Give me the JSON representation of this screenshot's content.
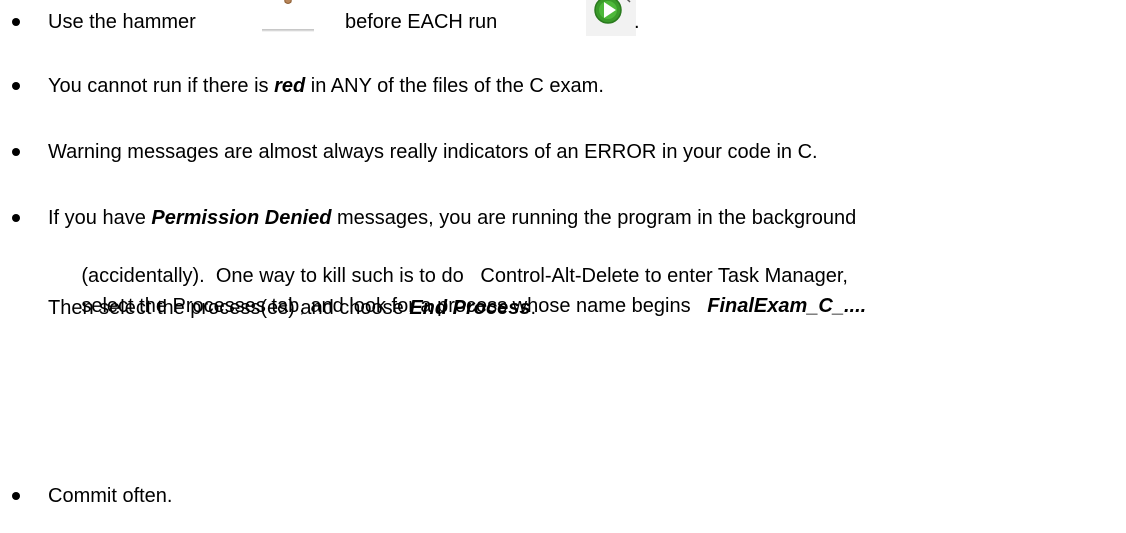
{
  "document": {
    "bullets": [
      {
        "parts": {
          "a": "Use the hammer",
          "b": "before EACH run",
          "c": "."
        }
      },
      {
        "parts": {
          "a": "You cannot run if there is ",
          "b": "red",
          "c": " in ANY of the files of the C exam."
        }
      },
      {
        "parts": {
          "a": "Warning messages are almost always really indicators of an ERROR in your code in C."
        }
      },
      {
        "lines": {
          "l1a": "If you have ",
          "l1b": "Permission Denied",
          "l1c": " messages, you are running the program in the background",
          "l2": "(accidentally).  One way to kill such is to do   Control-Alt-Delete to enter Task Manager,",
          "l3a": "select the Processes tab, and look for a process whose name begins   ",
          "l3b": "FinalExam_C_....",
          "l4a": "Then select the process(es) and choose ",
          "l4b": "End Process",
          "l4c": "."
        }
      },
      {
        "parts": {
          "a": "Commit often."
        }
      }
    ],
    "icons": {
      "hammer": "hammer-icon",
      "run": "run-icon"
    },
    "colors": {
      "text": "#000000",
      "run_icon_green": "#3a9a2a"
    }
  }
}
